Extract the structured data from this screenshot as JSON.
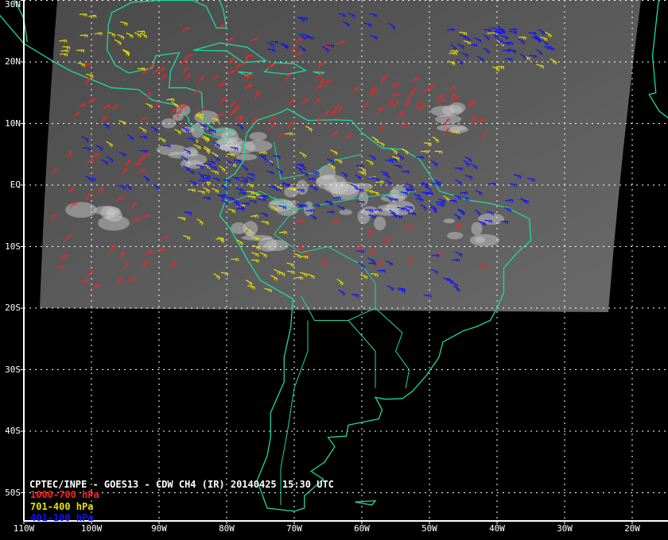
{
  "title": "CPTEC/INPE - GOES13 - CDW CH4 (IR) 20140425 15:30 UTC",
  "legend": [
    {
      "label": "1000-700 hPa",
      "color": "#ff2020"
    },
    {
      "label": "701-400 hPa",
      "color": "#e8e000"
    },
    {
      "label": "401-100 hPa",
      "color": "#1010ff"
    }
  ],
  "coast_color": "#20d8a0",
  "lat_labels": [
    "30N",
    "20N",
    "10N",
    "EQ",
    "10S",
    "20S",
    "30S",
    "40S",
    "50S"
  ],
  "lon_labels": [
    "110W",
    "100W",
    "90W",
    "80W",
    "70W",
    "60W",
    "50W",
    "40W",
    "30W",
    "20W"
  ]
}
